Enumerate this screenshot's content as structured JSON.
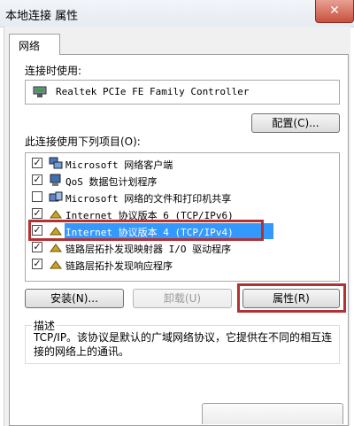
{
  "window": {
    "title": "本地连接 属性",
    "close_glyph": "✕"
  },
  "tabs": [
    {
      "label": "网络"
    }
  ],
  "connect_using": {
    "label": "连接时使用:",
    "adapter": "Realtek PCIe FE Family Controller",
    "configure_button": "配置(C)..."
  },
  "items_section": {
    "label": "此连接使用下列项目(O):",
    "items": [
      {
        "text": "Microsoft 网络客户端",
        "checked": true,
        "icon": "network-client-icon"
      },
      {
        "text": "QoS 数据包计划程序",
        "checked": true,
        "icon": "qos-scheduler-icon"
      },
      {
        "text": "Microsoft 网络的文件和打印机共享",
        "checked": false,
        "icon": "file-printer-sharing-icon"
      },
      {
        "text": "Internet 协议版本 6 (TCP/IPv6)",
        "checked": true,
        "icon": "protocol-icon"
      },
      {
        "text": "Internet 协议版本 4 (TCP/IPv4)",
        "checked": true,
        "icon": "protocol-icon",
        "selected": true
      },
      {
        "text": "链路层拓扑发现映射器 I/O 驱动程序",
        "checked": true,
        "icon": "protocol-icon"
      },
      {
        "text": "链路层拓扑发现响应程序",
        "checked": true,
        "icon": "protocol-icon"
      }
    ]
  },
  "buttons": {
    "install": "安装(N)...",
    "uninstall": "卸载(U)",
    "properties": "属性(R)"
  },
  "description": {
    "title": "描述",
    "text": "TCP/IP。该协议是默认的广域网络协议，它提供在不同的相互连接的网络上的通讯。"
  },
  "colors": {
    "selection": "#3399ff",
    "annotation": "#b23234",
    "close_button": "#c8503d"
  }
}
